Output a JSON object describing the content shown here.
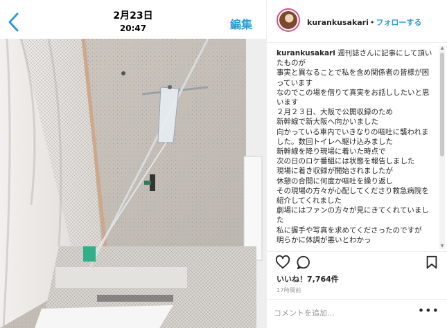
{
  "photo_header": {
    "date": "2月23日",
    "time": "20:47",
    "edit_label": "編集"
  },
  "post": {
    "username": "kurankusakari",
    "dot": "•",
    "follow_label": "フォローする",
    "caption_username": "kurankusakari",
    "caption_body": " 週刊誌さんに記事にして頂いたものが\n事実と異なることで私を含め関係者の皆様が困っています\nなのでこの場を借りて真実をお話ししたいと思います\n２月２３日、大阪で公開収録のため\n新幹線で新大阪へ向かいました\n向かっている車内でいきなりの嘔吐に襲われました。数回トイレへ駆け込みました\n新幹線を降り現場に着いた時点で\n次の日のロケ番組には状態を報告しました\n現場に着き収録が開始されましたが\n休憩の合間に何度か嘔吐を繰り返し\nその現場の方々が心配してくださり救急病院を紹介してくれました\n劇場にはファンの方々が見にきてくれていました\n私に握手や写真を求めてくださったのですが\n明らかに体調が悪いとわかっ",
    "likes": "いいね！7,764件",
    "age": "17時間前",
    "comment_placeholder": "コメントを追加...",
    "more_label": "•••"
  },
  "icons": {
    "back": "chevron-left-icon",
    "like": "heart-icon",
    "comment": "comment-bubble-icon",
    "save": "bookmark-icon"
  },
  "colors": {
    "link_blue": "#2a9cd8",
    "text": "#262626",
    "muted": "#999999",
    "avatar_ring": "#d64f8a"
  }
}
